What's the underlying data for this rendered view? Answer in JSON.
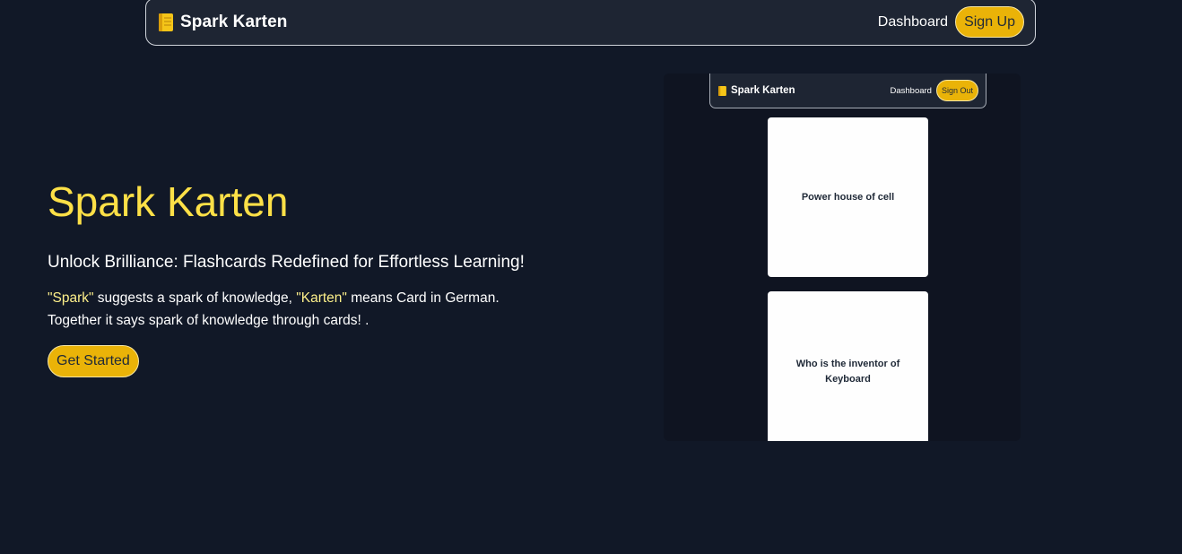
{
  "navbar": {
    "brand": "Spark Karten",
    "brand_icon": "notebook-icon",
    "dashboard_link": "Dashboard",
    "signup_label": "Sign Up"
  },
  "hero": {
    "title": "Spark Karten",
    "subtitle": "Unlock Brilliance: Flashcards Redefined for Effortless Learning!",
    "desc_spark": "\"Spark\"",
    "desc_part1": " suggests a spark of knowledge, ",
    "desc_karten": "\"Karten\"",
    "desc_part2": " means Card in German.",
    "desc_line2": "Together it says spark of knowledge through cards! .",
    "cta_label": "Get Started"
  },
  "preview": {
    "nav_brand": "Spark Karten",
    "nav_dashboard": "Dashboard",
    "nav_signout": "Sign Out",
    "cards": [
      {
        "text": "Power house of cell"
      },
      {
        "text": "Who is the inventor of Keyboard"
      }
    ]
  },
  "colors": {
    "background": "#111827",
    "navbar": "#1e2533",
    "accent": "#eab308",
    "title": "#fde047",
    "highlight": "#fef08a"
  }
}
